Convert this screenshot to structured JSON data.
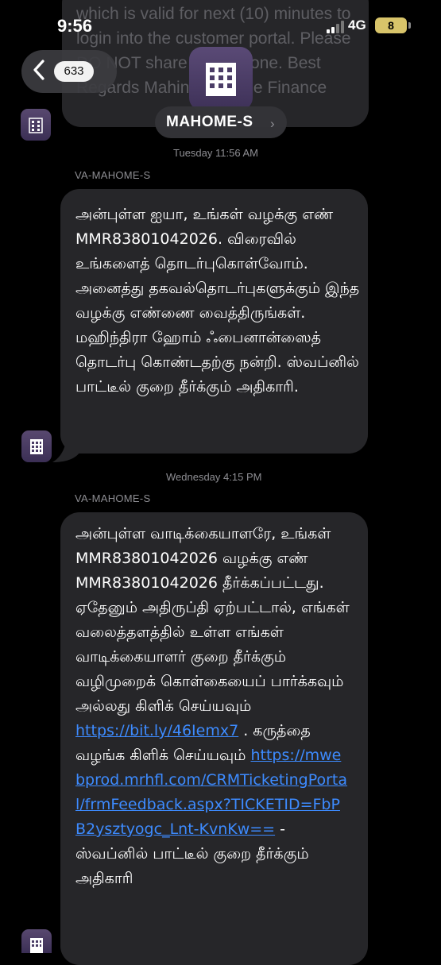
{
  "status_bar": {
    "time": "9:56",
    "network": "4G",
    "battery": "8"
  },
  "previous_message": {
    "text": "which is valid for next (10) minutes to login into the customer portal. Please DO NOT share it to anyone. Best Regards Mahindra Home Finance"
  },
  "header": {
    "back_badge": "633",
    "contact_name": "MAHOME-S",
    "contact_chevron": "›"
  },
  "messages": [
    {
      "timestamp": "Tuesday 11:56 AM",
      "sender": "VA-MAHOME-S",
      "text": "அன்புள்ள ஐயா, உங்கள் வழக்கு எண் MMR83801042026. விரைவில் உங்களைத் தொடர்புகொள்வோம். அனைத்து தகவல்தொடர்புகளுக்கும் இந்த வழக்கு எண்ணை வைத்திருங்கள். மஹிந்திரா ஹோம் ஃபைனான்ஸைத் தொடர்பு கொண்டதற்கு நன்றி. ஸ்வப்னில் பாட்டீல் குறை தீர்க்கும் அதிகாரி."
    },
    {
      "timestamp": "Wednesday 4:15 PM",
      "sender": "VA-MAHOME-S",
      "text_part1": "அன்புள்ள வாடிக்கையாளரே, உங்கள் MMR83801042026 வழக்கு எண் MMR83801042026 தீர்க்கப்பட்டது. ஏதேனும் அதிருப்தி ஏற்பட்டால், எங்கள் வலைத்தளத்தில் உள்ள எங்கள் வாடிக்கையாளர் குறை தீர்க்கும் வழிமுறைக் கொள்கையைப் பார்க்கவும் அல்லது கிளிக் செய்யவும்",
      "link1": "https://bit.ly/46Iemx7",
      "text_part2": " . கருத்தை வழங்க கிளிக் செய்யவும் ",
      "link2": "https://mwebprod.mrhfl.com/CRMTicketingPortal/frmFeedback.aspx?TICKETID=FbPB2ysztyogc_Lnt-KvnKw==",
      "text_part3": "  - ஸ்வப்னில் பாட்டீல் குறை தீர்க்கும் அதிகாரி"
    }
  ],
  "icons": {
    "back": "chevron-left-icon",
    "contact": "building-icon"
  }
}
